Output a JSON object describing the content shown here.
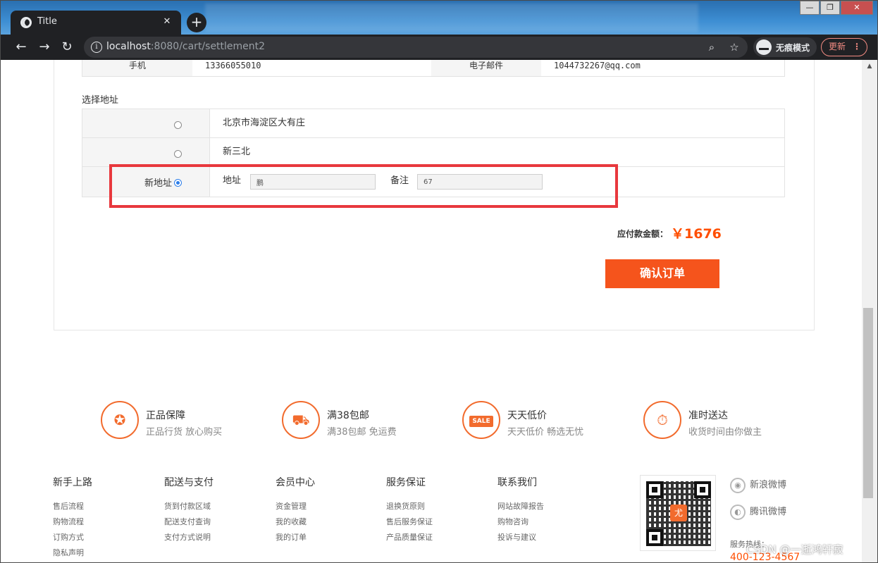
{
  "browser": {
    "tab_title": "Title",
    "tab_close": "✕",
    "new_tab": "+",
    "url_host": "localhost",
    "url_rest": ":8080/cart/settlement2",
    "incognito_label": "无痕模式",
    "update_label": "更新",
    "window_controls": {
      "minimize": "—",
      "maximize": "❐",
      "close": "✕"
    }
  },
  "contact": {
    "phone_label": "手机",
    "phone_value": "13366055010",
    "email_label": "电子邮件",
    "email_value": "1044732267@qq.com"
  },
  "address": {
    "section_title": "选择地址",
    "options": [
      {
        "text": "北京市海淀区大有庄",
        "selected": false
      },
      {
        "text": "新三北",
        "selected": false
      }
    ],
    "new_address": {
      "label": "新地址",
      "selected": true,
      "address_label": "地址",
      "address_value": "鹏",
      "note_label": "备注",
      "note_value": "67"
    }
  },
  "order": {
    "total_label": "应付款金额：",
    "total_amount": "￥1676",
    "confirm_button": "确认订单"
  },
  "services": [
    {
      "title": "正品保障",
      "subtitle": "正品行货 放心购买",
      "icon": "ribbon-icon"
    },
    {
      "title": "满38包邮",
      "subtitle": "满38包邮 免运费",
      "icon": "truck-icon"
    },
    {
      "title": "天天低价",
      "subtitle": "天天低价 畅选无忧",
      "icon": "sale-tag-icon",
      "badge": "SALE"
    },
    {
      "title": "准时送达",
      "subtitle": "收货时间由你做主",
      "icon": "stopwatch-icon"
    }
  ],
  "footer": {
    "columns": [
      {
        "title": "新手上路",
        "links": [
          "售后流程",
          "购物流程",
          "订购方式",
          "隐私声明"
        ]
      },
      {
        "title": "配送与支付",
        "links": [
          "货到付款区域",
          "配送支付查询",
          "支付方式说明"
        ]
      },
      {
        "title": "会员中心",
        "links": [
          "资金管理",
          "我的收藏",
          "我的订单"
        ]
      },
      {
        "title": "服务保证",
        "links": [
          "退换货原则",
          "售后服务保证",
          "产品质量保证"
        ]
      },
      {
        "title": "联系我们",
        "links": [
          "网站故障报告",
          "购物咨询",
          "投诉与建议"
        ]
      }
    ],
    "qr_center": "尤",
    "weibo": "新浪微博",
    "tencent_weibo": "腾讯微博",
    "hotline_label": "服务热线：",
    "hotline_number": "400-123-4567",
    "watermark": "CSDN @一逝鸿轩寂"
  },
  "colors": {
    "accent": "#f5541c",
    "price": "#ff4e00",
    "highlight_box": "#e8383d",
    "radio_selected": "#2b7de9"
  }
}
